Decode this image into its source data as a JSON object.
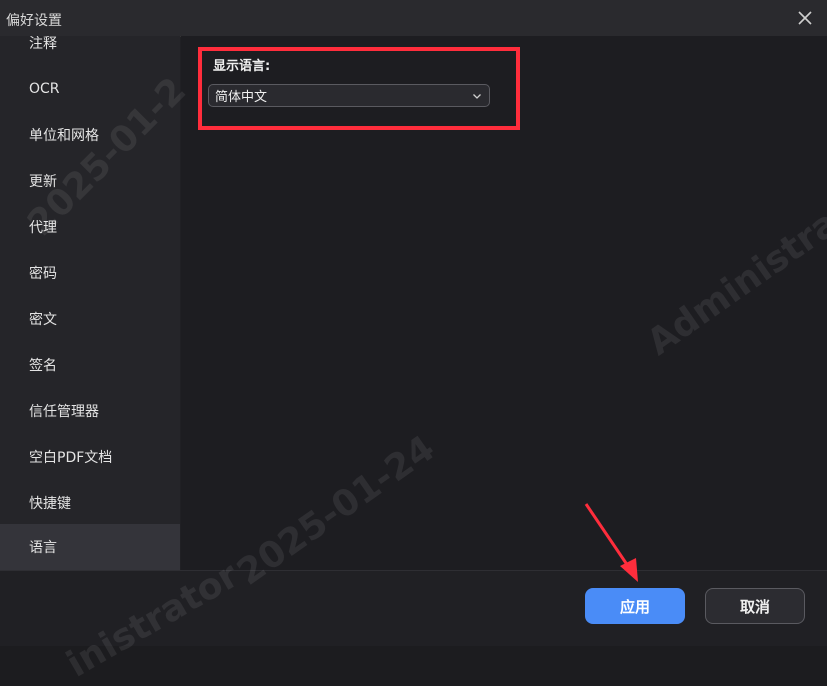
{
  "window": {
    "title": "偏好设置"
  },
  "sidebar": {
    "items": [
      {
        "label": "注释"
      },
      {
        "label": "OCR"
      },
      {
        "label": "单位和网格"
      },
      {
        "label": "更新"
      },
      {
        "label": "代理"
      },
      {
        "label": "密码"
      },
      {
        "label": "密文"
      },
      {
        "label": "签名"
      },
      {
        "label": "信任管理器"
      },
      {
        "label": "空白PDF文档"
      },
      {
        "label": "快捷键"
      },
      {
        "label": "语言"
      }
    ],
    "active": "语言"
  },
  "language": {
    "label": "显示语言:",
    "selected": "简体中文"
  },
  "footer": {
    "apply_label": "应用",
    "cancel_label": "取消"
  },
  "watermarks": {
    "a": "2025-01-2",
    "b": "Administra",
    "c": "2025-01-24",
    "d": "inistrator"
  },
  "colors": {
    "accent": "#4a8cf7",
    "highlight": "#ff2d3c"
  },
  "icons": {
    "close": "close-icon",
    "dropdown": "chevron-down-icon",
    "annotation_arrow": "arrow-icon"
  }
}
